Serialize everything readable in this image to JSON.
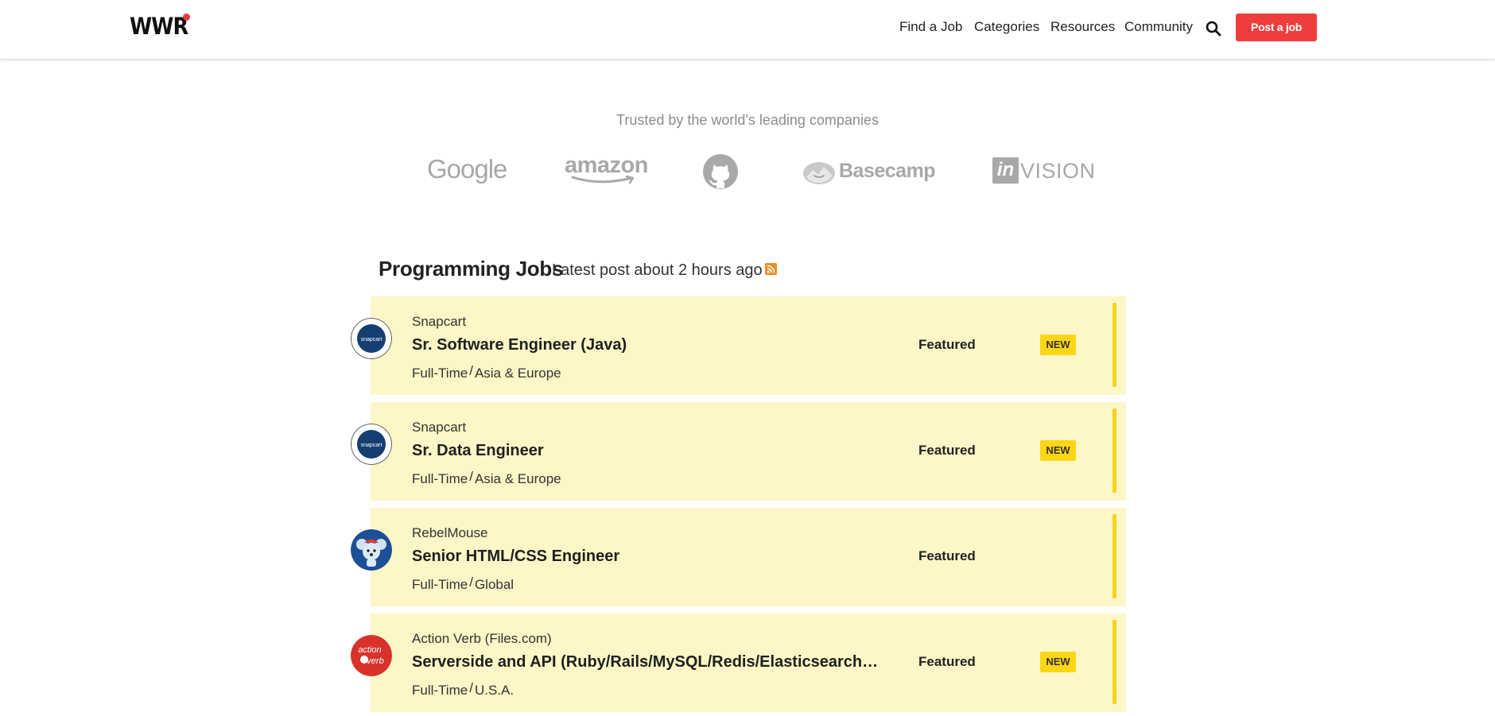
{
  "header": {
    "logo": "WWR",
    "nav": [
      "Find a Job",
      "Categories",
      "Resources",
      "Community"
    ],
    "post_button": "Post a job"
  },
  "trusted": {
    "heading": "Trusted by the world's leading companies",
    "companies": [
      "Google",
      "amazon",
      "GitHub",
      "Basecamp",
      "invision"
    ]
  },
  "section": {
    "title": "Programming Jobs",
    "subtitle": "Latest post about 2 hours ago"
  },
  "jobs": [
    {
      "company": "Snapcart",
      "title": "Sr. Software Engineer (Java)",
      "type": "Full-Time",
      "region": "Asia & Europe",
      "featured": "Featured",
      "badge": "NEW",
      "logo_text": "snapcart"
    },
    {
      "company": "Snapcart",
      "title": "Sr. Data Engineer",
      "type": "Full-Time",
      "region": "Asia & Europe",
      "featured": "Featured",
      "badge": "NEW",
      "logo_text": "snapcart"
    },
    {
      "company": "RebelMouse",
      "title": "Senior HTML/CSS Engineer",
      "type": "Full-Time",
      "region": "Global",
      "featured": "Featured",
      "badge": "",
      "logo_text": ""
    },
    {
      "company": "Action Verb (Files.com)",
      "title": "Serverside and API (Ruby/Rails/MySQL/Redis/Elasticsearch…",
      "type": "Full-Time",
      "region": "U.S.A.",
      "featured": "Featured",
      "badge": "NEW",
      "logo_text": "action verb"
    }
  ],
  "colors": {
    "accent": "#ef3d3d",
    "job_bg": "#fdf6c6",
    "badge": "#fcd615",
    "logo_gray": "#a8a8a8"
  }
}
